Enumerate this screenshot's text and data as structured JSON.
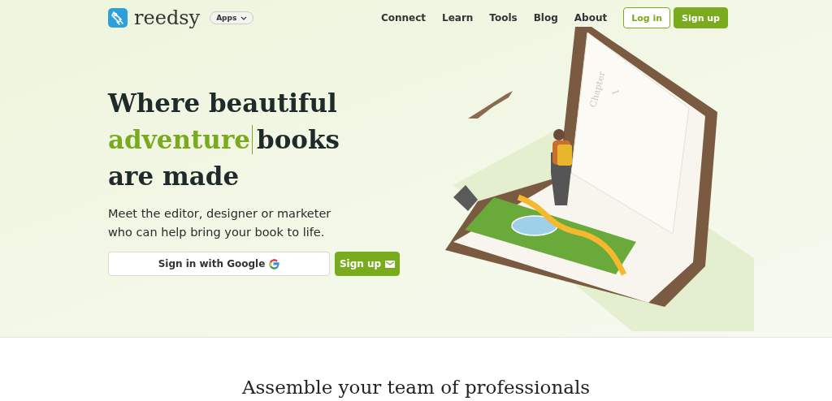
{
  "header": {
    "brand": "reedsy",
    "apps_menu": {
      "label": "Apps",
      "expanded": false
    },
    "nav_links": [
      "Connect",
      "Learn",
      "Tools",
      "Blog",
      "About"
    ],
    "buttons": [
      {
        "label": "Log in",
        "kind": "outline"
      },
      {
        "label": "Sign up",
        "kind": "filled"
      }
    ]
  },
  "hero": {
    "headline_lines": [
      [
        {
          "text": "Where beautiful",
          "highlight": false,
          "cursor_after": false
        }
      ],
      [
        {
          "text": "adventure",
          "highlight": true,
          "cursor_after": true
        },
        {
          "text": "books",
          "highlight": false,
          "cursor_after": false
        }
      ],
      [
        {
          "text": "are made",
          "highlight": false,
          "cursor_after": false
        }
      ]
    ],
    "subtitle": "Meet the editor, designer or marketer who can help bring your book to life.",
    "actions": [
      {
        "label": "Sign in with Google",
        "kind": "google"
      },
      {
        "label": "Sign up",
        "kind": "email"
      }
    ],
    "illustration": {
      "page_numeral": "I",
      "page_heading": "Chapter"
    }
  },
  "section": {
    "title": "Assemble your team of professionals"
  }
}
